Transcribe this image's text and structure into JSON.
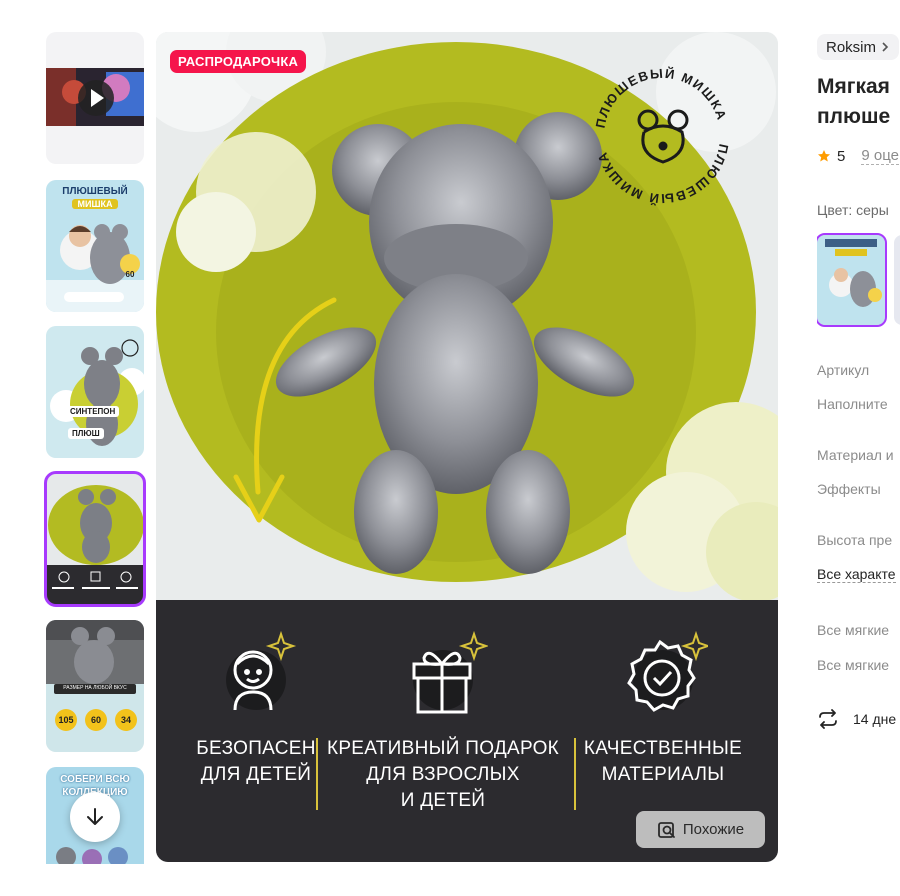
{
  "gallery": {
    "thumbnails": [
      {
        "kind": "video"
      },
      {
        "kind": "image",
        "title_line1": "ПЛЮШЕВЫЙ",
        "title_line2": "МИШКА",
        "badge": "60"
      },
      {
        "kind": "image",
        "label_a": "СИНТЕПОН",
        "label_b": "ПЛЮШ"
      },
      {
        "kind": "image",
        "active": true
      },
      {
        "kind": "image",
        "caption": "РАЗМЕР НА ЛЮБОЙ ВКУС",
        "sizes": [
          "105",
          "60",
          "34"
        ]
      },
      {
        "kind": "image",
        "title": "СОБЕРИ ВСЮ КОЛЛЕКЦИЮ"
      }
    ],
    "scroll_icon": "arrow-down-icon"
  },
  "main_image": {
    "sale_badge": "РАСПРОДАРОЧКА",
    "stamp_text": "ПЛЮШЕВЫЙ МИШКА",
    "features": [
      {
        "icon": "child-icon",
        "text": "БЕЗОПАСЕН\nДЛЯ ДЕТЕЙ"
      },
      {
        "icon": "gift-icon",
        "text": "КРЕАТИВНЫЙ ПОДАРОК\nДЛЯ ВЗРОСЛЫХ\nИ ДЕТЕЙ"
      },
      {
        "icon": "quality-badge-icon",
        "text": "КАЧЕСТВЕННЫЕ\nМАТЕРИАЛЫ"
      }
    ],
    "similar_button": "Похожие"
  },
  "product": {
    "brand": "Roksim",
    "title": "Мягкая\nплюше",
    "rating": "5",
    "reviews": "9 оце",
    "color_label": "Цвет: серы",
    "specs": [
      "Артикул",
      "Наполните",
      "Материал и",
      "Эффекты",
      "Высота пре"
    ],
    "all_specs_link": "Все характе",
    "links": [
      "Все мягкие",
      "Все мягкие"
    ],
    "return_text": "14 дне"
  },
  "colors": {
    "accent": "#a73afd",
    "sale": "#f5154b",
    "rating_star": "#ff9c00",
    "olive": "#b5bd2a",
    "band": "#2c2b2f",
    "gold": "#d8c23b"
  }
}
